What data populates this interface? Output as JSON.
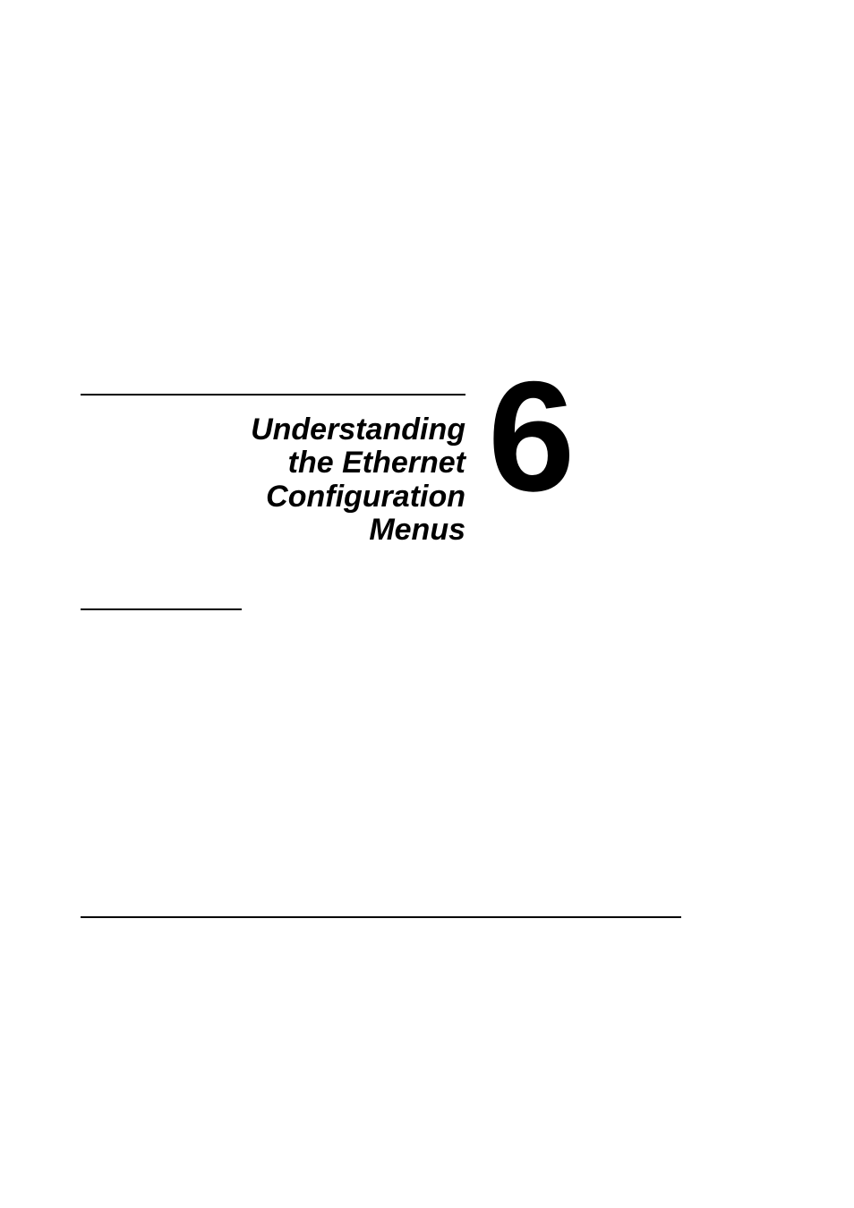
{
  "chapter": {
    "number": "6",
    "title_line1": "Understanding",
    "title_line2": "the Ethernet",
    "title_line3": "Configuration",
    "title_line4": "Menus"
  }
}
